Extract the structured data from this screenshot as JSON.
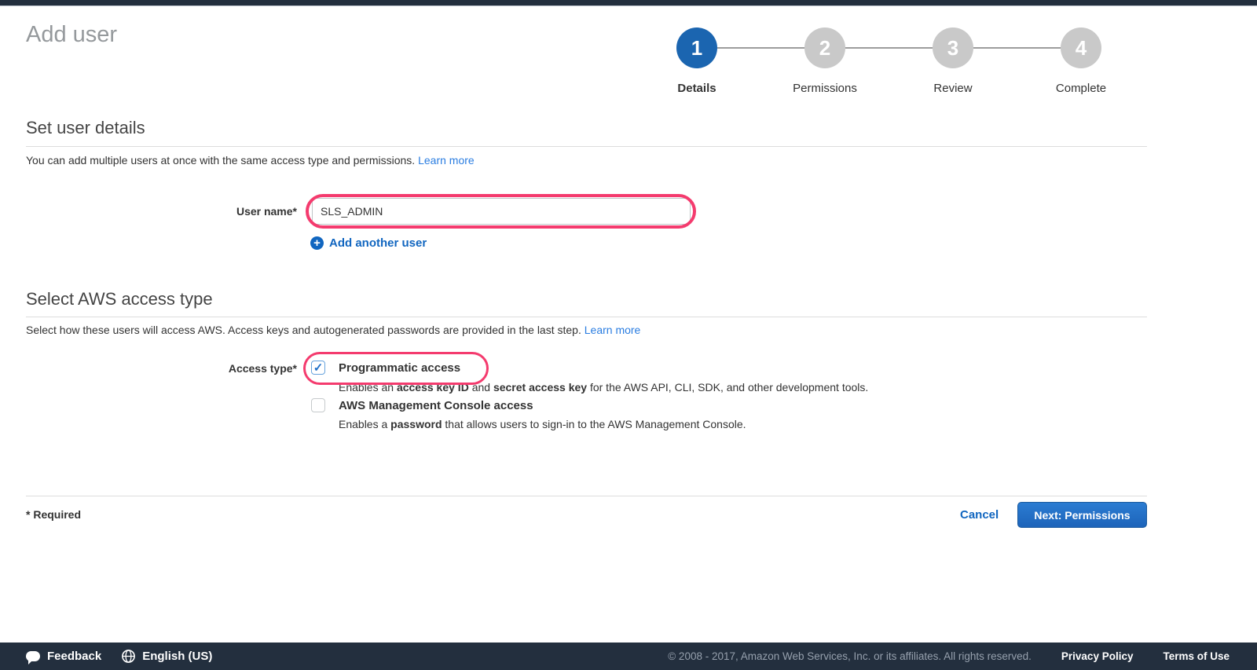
{
  "header": {
    "title": "Add user"
  },
  "steps": [
    {
      "num": "1",
      "label": "Details"
    },
    {
      "num": "2",
      "label": "Permissions"
    },
    {
      "num": "3",
      "label": "Review"
    },
    {
      "num": "4",
      "label": "Complete"
    }
  ],
  "user_details": {
    "heading": "Set user details",
    "intro": "You can add multiple users at once with the same access type and permissions. ",
    "learn_more": "Learn more",
    "username_label": "User name*",
    "username_value": "SLS_ADMIN",
    "add_another": "Add another user"
  },
  "access_type": {
    "heading": "Select AWS access type",
    "intro": "Select how these users will access AWS. Access keys and autogenerated passwords are provided in the last step. ",
    "learn_more": "Learn more",
    "label": "Access type*",
    "programmatic": {
      "label": "Programmatic access",
      "checked": true,
      "desc_p1": "Enables an ",
      "desc_b1": "access key ID",
      "desc_p2": " and ",
      "desc_b2": "secret access key",
      "desc_p3": " for the AWS API, CLI, SDK, and other development tools."
    },
    "console": {
      "label": "AWS Management Console access",
      "checked": false,
      "desc_p1": "Enables a ",
      "desc_b1": "password",
      "desc_p2": " that allows users to sign-in to the AWS Management Console."
    }
  },
  "actions": {
    "required_note": "* Required",
    "cancel": "Cancel",
    "next": "Next: Permissions"
  },
  "footer": {
    "feedback": "Feedback",
    "language": "English (US)",
    "copyright": "© 2008 - 2017, Amazon Web Services, Inc. or its affiliates. All rights reserved.",
    "privacy": "Privacy Policy",
    "terms": "Terms of Use"
  },
  "icons": {
    "check_glyph": "✓",
    "plus_glyph": "+"
  },
  "colors": {
    "accent_blue": "#1b65b0",
    "link_blue": "#2a7de1",
    "action_blue": "#1166c0",
    "annotation_pink": "#f43b6e",
    "bar_navy": "#232f3e"
  }
}
